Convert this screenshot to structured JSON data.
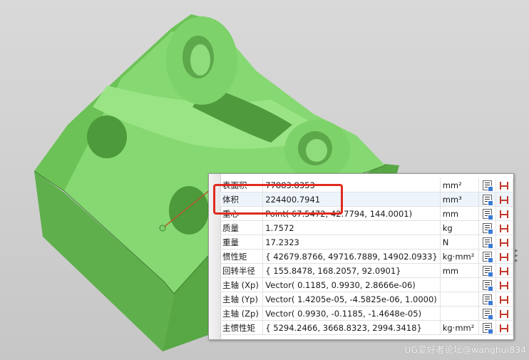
{
  "colors": {
    "part_green": "#7ed26a",
    "highlight": "#e02b20"
  },
  "measurements": [
    {
      "name": "表面积",
      "value": "77883.8353",
      "unit": "mm²"
    },
    {
      "name": "体积",
      "value": "224400.7941",
      "unit": "mm³"
    },
    {
      "name": "重心",
      "value": "Point( 67.5472, 42.7794, 144.0001)",
      "unit": "mm"
    },
    {
      "name": "质量",
      "value": "1.7572",
      "unit": "kg"
    },
    {
      "name": "重量",
      "value": "17.2323",
      "unit": "N"
    },
    {
      "name": "惯性矩",
      "value": "{ 42679.8766, 49716.7889, 14902.0933}",
      "unit": "kg·mm²"
    },
    {
      "name": "回转半径",
      "value": "{ 155.8478, 168.2057, 92.0901}",
      "unit": "mm"
    },
    {
      "name": "主轴 (Xp)",
      "value": "Vector( 0.1185, 0.9930, 2.8666e-06)",
      "unit": ""
    },
    {
      "name": "主轴 (Yp)",
      "value": "Vector( 1.4205e-05, -4.5825e-06, 1.0000)",
      "unit": ""
    },
    {
      "name": "主轴 (Zp)",
      "value": "Vector( 0.9930, -0.1185, -1.4648e-05)",
      "unit": ""
    },
    {
      "name": "主惯性矩",
      "value": "{ 5294.2466, 3668.8323, 2994.3418}",
      "unit": "kg·mm²"
    }
  ],
  "icons": {
    "copy": "copy-to-info-icon",
    "export": "export-xy-icon"
  },
  "watermark": "UG爱好者论坛@wanghui834"
}
